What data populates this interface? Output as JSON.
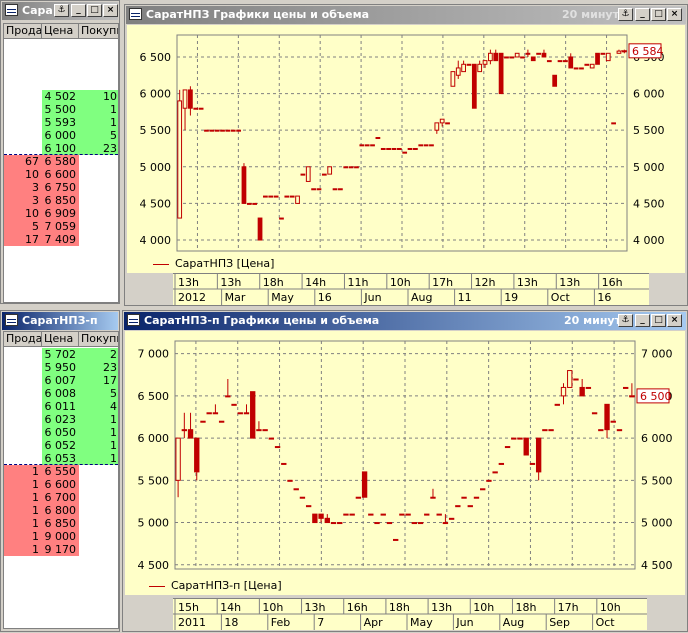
{
  "colors": {
    "ask": "#ff8080",
    "bid": "#80ff80",
    "chart_bg": "#ffffc8",
    "candle": "#c00000"
  },
  "book1": {
    "title": "Сара",
    "headers": [
      "Прода",
      "Цена",
      "Покупка"
    ],
    "rows": [
      {
        "sell": "",
        "price": "4 502",
        "buy": "10",
        "side": "bid"
      },
      {
        "sell": "",
        "price": "5 500",
        "buy": "1",
        "side": "bid"
      },
      {
        "sell": "",
        "price": "5 593",
        "buy": "1",
        "side": "bid"
      },
      {
        "sell": "",
        "price": "6 000",
        "buy": "5",
        "side": "bid"
      },
      {
        "sell": "",
        "price": "6 100",
        "buy": "23",
        "side": "bid"
      },
      {
        "sell": "67",
        "price": "6 580",
        "buy": "",
        "side": "ask"
      },
      {
        "sell": "10",
        "price": "6 600",
        "buy": "",
        "side": "ask"
      },
      {
        "sell": "3",
        "price": "6 750",
        "buy": "",
        "side": "ask"
      },
      {
        "sell": "3",
        "price": "6 850",
        "buy": "",
        "side": "ask"
      },
      {
        "sell": "10",
        "price": "6 909",
        "buy": "",
        "side": "ask"
      },
      {
        "sell": "5",
        "price": "7 059",
        "buy": "",
        "side": "ask"
      },
      {
        "sell": "17",
        "price": "7 409",
        "buy": "",
        "side": "ask"
      }
    ]
  },
  "book2": {
    "title": "СаратНПЗ-п",
    "headers": [
      "Прода",
      "Цена",
      "Покупка"
    ],
    "rows": [
      {
        "sell": "",
        "price": "5 702",
        "buy": "2",
        "side": "bid"
      },
      {
        "sell": "",
        "price": "5 950",
        "buy": "23",
        "side": "bid"
      },
      {
        "sell": "",
        "price": "6 007",
        "buy": "17",
        "side": "bid"
      },
      {
        "sell": "",
        "price": "6 008",
        "buy": "5",
        "side": "bid"
      },
      {
        "sell": "",
        "price": "6 011",
        "buy": "4",
        "side": "bid"
      },
      {
        "sell": "",
        "price": "6 023",
        "buy": "1",
        "side": "bid"
      },
      {
        "sell": "",
        "price": "6 050",
        "buy": "1",
        "side": "bid"
      },
      {
        "sell": "",
        "price": "6 052",
        "buy": "1",
        "side": "bid"
      },
      {
        "sell": "",
        "price": "6 053",
        "buy": "1",
        "side": "bid"
      },
      {
        "sell": "1",
        "price": "6 550",
        "buy": "",
        "side": "ask"
      },
      {
        "sell": "1",
        "price": "6 600",
        "buy": "",
        "side": "ask"
      },
      {
        "sell": "1",
        "price": "6 700",
        "buy": "",
        "side": "ask"
      },
      {
        "sell": "1",
        "price": "6 800",
        "buy": "",
        "side": "ask"
      },
      {
        "sell": "1",
        "price": "6 850",
        "buy": "",
        "side": "ask"
      },
      {
        "sell": "1",
        "price": "9 000",
        "buy": "",
        "side": "ask"
      },
      {
        "sell": "1",
        "price": "9 170",
        "buy": "",
        "side": "ask"
      }
    ]
  },
  "chart1": {
    "title": "СаратНПЗ Графики цены и объема",
    "interval": "20 минут",
    "legend": "СаратНПЗ [Цена]",
    "current": "6 584",
    "current_value": 6584,
    "ylim": [
      3850,
      6800
    ],
    "yticks": [
      4000,
      4500,
      5000,
      5500,
      6000,
      6500
    ],
    "ytick_labels": [
      "4 000",
      "4 500",
      "5 000",
      "5 500",
      "6 000",
      "6 500"
    ],
    "time_top": [
      "13h",
      "13h",
      "18h",
      "14h",
      "11h",
      "10h",
      "17h",
      "12h",
      "13h",
      "13h",
      "16h"
    ],
    "time_bottom": [
      "2012",
      "Mar",
      "May",
      "16",
      "Jun",
      "Aug",
      "11",
      "19",
      "Oct",
      "16"
    ],
    "series": [
      {
        "o": 4300,
        "c": 5900,
        "h": 6050,
        "l": 4300
      },
      {
        "o": 5800,
        "c": 6050,
        "h": 6050,
        "l": 5500
      },
      {
        "o": 6050,
        "c": 5800,
        "h": 6100,
        "l": 5700
      },
      {
        "o": 5800,
        "c": 5800,
        "h": 5800,
        "l": 5800
      },
      {
        "o": 5800,
        "c": 5800,
        "h": 5800,
        "l": 5800
      },
      {
        "o": 5500,
        "c": 5500,
        "h": 5500,
        "l": 5500
      },
      {
        "o": 5500,
        "c": 5500,
        "h": 5500,
        "l": 5500
      },
      {
        "o": 5500,
        "c": 5500,
        "h": 5500,
        "l": 5500
      },
      {
        "o": 5500,
        "c": 5500,
        "h": 5500,
        "l": 5500
      },
      {
        "o": 5500,
        "c": 5500,
        "h": 5500,
        "l": 5500
      },
      {
        "o": 5500,
        "c": 5500,
        "h": 5500,
        "l": 5500
      },
      {
        "o": 5500,
        "c": 5500,
        "h": 5500,
        "l": 5500
      },
      {
        "o": 5000,
        "c": 4500,
        "h": 5050,
        "l": 4500
      },
      {
        "o": 4500,
        "c": 4500,
        "h": 4500,
        "l": 4500
      },
      {
        "o": 4500,
        "c": 4500,
        "h": 4500,
        "l": 4500
      },
      {
        "o": 4300,
        "c": 4000,
        "h": 4300,
        "l": 4000
      },
      {
        "o": 4600,
        "c": 4600,
        "h": 4600,
        "l": 4600
      },
      {
        "o": 4600,
        "c": 4600,
        "h": 4600,
        "l": 4600
      },
      {
        "o": 4600,
        "c": 4600,
        "h": 4600,
        "l": 4600
      },
      {
        "o": 4300,
        "c": 4300,
        "h": 4300,
        "l": 4300
      },
      {
        "o": 4600,
        "c": 4600,
        "h": 4600,
        "l": 4600
      },
      {
        "o": 4600,
        "c": 4600,
        "h": 4600,
        "l": 4600
      },
      {
        "o": 4500,
        "c": 4600,
        "h": 4600,
        "l": 4500
      },
      {
        "o": 4900,
        "c": 4900,
        "h": 4900,
        "l": 4900
      },
      {
        "o": 4800,
        "c": 5000,
        "h": 5000,
        "l": 4800
      },
      {
        "o": 4700,
        "c": 4700,
        "h": 4700,
        "l": 4700
      },
      {
        "o": 4700,
        "c": 4700,
        "h": 4700,
        "l": 4700
      },
      {
        "o": 4900,
        "c": 4900,
        "h": 4900,
        "l": 4900
      },
      {
        "o": 4900,
        "c": 5000,
        "h": 5000,
        "l": 4900
      },
      {
        "o": 4700,
        "c": 4700,
        "h": 4700,
        "l": 4700
      },
      {
        "o": 4700,
        "c": 4700,
        "h": 4700,
        "l": 4700
      },
      {
        "o": 5000,
        "c": 5000,
        "h": 5000,
        "l": 5000
      },
      {
        "o": 5000,
        "c": 5000,
        "h": 5000,
        "l": 5000
      },
      {
        "o": 5000,
        "c": 5000,
        "h": 5000,
        "l": 5000
      },
      {
        "o": 5300,
        "c": 5300,
        "h": 5300,
        "l": 5300
      },
      {
        "o": 5300,
        "c": 5300,
        "h": 5300,
        "l": 5300
      },
      {
        "o": 5300,
        "c": 5300,
        "h": 5300,
        "l": 5300
      },
      {
        "o": 5400,
        "c": 5400,
        "h": 5400,
        "l": 5400
      },
      {
        "o": 5250,
        "c": 5250,
        "h": 5250,
        "l": 5250
      },
      {
        "o": 5250,
        "c": 5250,
        "h": 5250,
        "l": 5250
      },
      {
        "o": 5250,
        "c": 5250,
        "h": 5250,
        "l": 5250
      },
      {
        "o": 5250,
        "c": 5250,
        "h": 5250,
        "l": 5250
      },
      {
        "o": 5200,
        "c": 5200,
        "h": 5200,
        "l": 5200
      },
      {
        "o": 5250,
        "c": 5250,
        "h": 5250,
        "l": 5250
      },
      {
        "o": 5250,
        "c": 5250,
        "h": 5250,
        "l": 5250
      },
      {
        "o": 5300,
        "c": 5300,
        "h": 5300,
        "l": 5300
      },
      {
        "o": 5300,
        "c": 5300,
        "h": 5300,
        "l": 5300
      },
      {
        "o": 5300,
        "c": 5300,
        "h": 5300,
        "l": 5300
      },
      {
        "o": 5500,
        "c": 5600,
        "h": 5600,
        "l": 5450
      },
      {
        "o": 5600,
        "c": 5650,
        "h": 5650,
        "l": 5550
      },
      {
        "o": 5600,
        "c": 5600,
        "h": 5600,
        "l": 5600
      },
      {
        "o": 6100,
        "c": 6300,
        "h": 6300,
        "l": 6100
      },
      {
        "o": 6250,
        "c": 6350,
        "h": 6450,
        "l": 6200
      },
      {
        "o": 6300,
        "c": 6400,
        "h": 6450,
        "l": 6300
      },
      {
        "o": 6400,
        "c": 6400,
        "h": 6400,
        "l": 6400
      },
      {
        "o": 6400,
        "c": 5800,
        "h": 6400,
        "l": 5800
      },
      {
        "o": 6300,
        "c": 6400,
        "h": 6450,
        "l": 6300
      },
      {
        "o": 6400,
        "c": 6450,
        "h": 6450,
        "l": 6350
      },
      {
        "o": 6450,
        "c": 6550,
        "h": 6600,
        "l": 6400
      },
      {
        "o": 6550,
        "c": 6450,
        "h": 6600,
        "l": 6450
      },
      {
        "o": 6550,
        "c": 6000,
        "h": 6550,
        "l": 6000
      },
      {
        "o": 6500,
        "c": 6500,
        "h": 6500,
        "l": 6500
      },
      {
        "o": 6500,
        "c": 6500,
        "h": 6500,
        "l": 6500
      },
      {
        "o": 6500,
        "c": 6550,
        "h": 6550,
        "l": 6500
      },
      {
        "o": 6500,
        "c": 6500,
        "h": 6500,
        "l": 6500
      },
      {
        "o": 6550,
        "c": 6550,
        "h": 6600,
        "l": 6500
      },
      {
        "o": 6500,
        "c": 6450,
        "h": 6500,
        "l": 6450
      },
      {
        "o": 6550,
        "c": 6550,
        "h": 6550,
        "l": 6550
      },
      {
        "o": 6550,
        "c": 6500,
        "h": 6600,
        "l": 6500
      },
      {
        "o": 6450,
        "c": 6450,
        "h": 6450,
        "l": 6450
      },
      {
        "o": 6250,
        "c": 6100,
        "h": 6250,
        "l": 6100
      },
      {
        "o": 6450,
        "c": 6450,
        "h": 6450,
        "l": 6450
      },
      {
        "o": 6450,
        "c": 6450,
        "h": 6450,
        "l": 6450
      },
      {
        "o": 6500,
        "c": 6350,
        "h": 6550,
        "l": 6350
      },
      {
        "o": 6350,
        "c": 6350,
        "h": 6350,
        "l": 6350
      },
      {
        "o": 6350,
        "c": 6350,
        "h": 6350,
        "l": 6350
      },
      {
        "o": 6400,
        "c": 6400,
        "h": 6400,
        "l": 6400
      },
      {
        "o": 6350,
        "c": 6400,
        "h": 6400,
        "l": 6350
      },
      {
        "o": 6550,
        "c": 6400,
        "h": 6550,
        "l": 6400
      },
      {
        "o": 6550,
        "c": 6550,
        "h": 6550,
        "l": 6550
      },
      {
        "o": 6450,
        "c": 6550,
        "h": 6550,
        "l": 6450
      },
      {
        "o": 5600,
        "c": 5600,
        "h": 5600,
        "l": 5600
      },
      {
        "o": 6550,
        "c": 6580,
        "h": 6600,
        "l": 6550
      },
      {
        "o": 6580,
        "c": 6584,
        "h": 6600,
        "l": 6550
      }
    ]
  },
  "chart2": {
    "title": "СаратНПЗ-п Графики цены и объема",
    "interval": "20 минут",
    "legend": "СаратНПЗ-п [Цена]",
    "current": "6 500",
    "current_value": 6500,
    "ylim": [
      4450,
      7150
    ],
    "yticks": [
      4500,
      5000,
      5500,
      6000,
      6500,
      7000
    ],
    "ytick_labels": [
      "4 500",
      "5 000",
      "5 500",
      "6 000",
      "6 500",
      "7 000"
    ],
    "time_top": [
      "15h",
      "14h",
      "10h",
      "13h",
      "16h",
      "18h",
      "13h",
      "10h",
      "18h",
      "17h",
      "10h"
    ],
    "time_bottom": [
      "2011",
      "18",
      "Feb",
      "7",
      "Apr",
      "May",
      "Jun",
      "Aug",
      "Sep",
      "Oct"
    ],
    "series": [
      {
        "o": 5500,
        "c": 6000,
        "h": 6000,
        "l": 5300
      },
      {
        "o": 6100,
        "c": 6100,
        "h": 6300,
        "l": 6000
      },
      {
        "o": 6100,
        "c": 6000,
        "h": 6300,
        "l": 6000
      },
      {
        "o": 6000,
        "c": 5600,
        "h": 6000,
        "l": 5500
      },
      {
        "o": 6200,
        "c": 6200,
        "h": 6200,
        "l": 6200
      },
      {
        "o": 6300,
        "c": 6300,
        "h": 6300,
        "l": 6300
      },
      {
        "o": 6300,
        "c": 6300,
        "h": 6400,
        "l": 6300
      },
      {
        "o": 6200,
        "c": 6200,
        "h": 6200,
        "l": 6200
      },
      {
        "o": 6500,
        "c": 6500,
        "h": 6700,
        "l": 6500
      },
      {
        "o": 6400,
        "c": 6400,
        "h": 6400,
        "l": 6400
      },
      {
        "o": 6300,
        "c": 6300,
        "h": 6300,
        "l": 6300
      },
      {
        "o": 6300,
        "c": 6300,
        "h": 6400,
        "l": 6300
      },
      {
        "o": 6550,
        "c": 6000,
        "h": 6550,
        "l": 6000
      },
      {
        "o": 6100,
        "c": 6100,
        "h": 6200,
        "l": 6100
      },
      {
        "o": 6100,
        "c": 6100,
        "h": 6100,
        "l": 6100
      },
      {
        "o": 6000,
        "c": 6000,
        "h": 6000,
        "l": 6000
      },
      {
        "o": 5900,
        "c": 5900,
        "h": 5900,
        "l": 5900
      },
      {
        "o": 5700,
        "c": 5700,
        "h": 5700,
        "l": 5700
      },
      {
        "o": 5500,
        "c": 5500,
        "h": 5500,
        "l": 5500
      },
      {
        "o": 5400,
        "c": 5400,
        "h": 5400,
        "l": 5400
      },
      {
        "o": 5300,
        "c": 5300,
        "h": 5300,
        "l": 5300
      },
      {
        "o": 5200,
        "c": 5200,
        "h": 5200,
        "l": 5200
      },
      {
        "o": 5100,
        "c": 5000,
        "h": 5100,
        "l": 5000
      },
      {
        "o": 5100,
        "c": 5050,
        "h": 5100,
        "l": 5000
      },
      {
        "o": 5050,
        "c": 5000,
        "h": 5100,
        "l": 5000
      },
      {
        "o": 5000,
        "c": 5000,
        "h": 5000,
        "l": 5000
      },
      {
        "o": 5000,
        "c": 5000,
        "h": 5000,
        "l": 5000
      },
      {
        "o": 5100,
        "c": 5100,
        "h": 5100,
        "l": 5100
      },
      {
        "o": 5100,
        "c": 5100,
        "h": 5100,
        "l": 5100
      },
      {
        "o": 5300,
        "c": 5300,
        "h": 5300,
        "l": 5300
      },
      {
        "o": 5600,
        "c": 5300,
        "h": 5600,
        "l": 5300
      },
      {
        "o": 5100,
        "c": 5100,
        "h": 5100,
        "l": 5100
      },
      {
        "o": 5000,
        "c": 5000,
        "h": 5000,
        "l": 5000
      },
      {
        "o": 5100,
        "c": 5100,
        "h": 5100,
        "l": 5100
      },
      {
        "o": 5000,
        "c": 5000,
        "h": 5000,
        "l": 5000
      },
      {
        "o": 4800,
        "c": 4800,
        "h": 4800,
        "l": 4800
      },
      {
        "o": 5100,
        "c": 5100,
        "h": 5100,
        "l": 5100
      },
      {
        "o": 5100,
        "c": 5100,
        "h": 5100,
        "l": 5100
      },
      {
        "o": 5000,
        "c": 5000,
        "h": 5000,
        "l": 5000
      },
      {
        "o": 5000,
        "c": 5000,
        "h": 5000,
        "l": 5000
      },
      {
        "o": 5100,
        "c": 5100,
        "h": 5100,
        "l": 5100
      },
      {
        "o": 5300,
        "c": 5300,
        "h": 5400,
        "l": 5300
      },
      {
        "o": 5100,
        "c": 5100,
        "h": 5100,
        "l": 5100
      },
      {
        "o": 5000,
        "c": 5000,
        "h": 5100,
        "l": 5000
      },
      {
        "o": 5050,
        "c": 5050,
        "h": 5050,
        "l": 5050
      },
      {
        "o": 5200,
        "c": 5200,
        "h": 5200,
        "l": 5200
      },
      {
        "o": 5300,
        "c": 5300,
        "h": 5300,
        "l": 5300
      },
      {
        "o": 5200,
        "c": 5200,
        "h": 5200,
        "l": 5200
      },
      {
        "o": 5300,
        "c": 5300,
        "h": 5300,
        "l": 5300
      },
      {
        "o": 5400,
        "c": 5400,
        "h": 5400,
        "l": 5400
      },
      {
        "o": 5500,
        "c": 5500,
        "h": 5500,
        "l": 5500
      },
      {
        "o": 5600,
        "c": 5600,
        "h": 5600,
        "l": 5600
      },
      {
        "o": 5700,
        "c": 5700,
        "h": 5700,
        "l": 5700
      },
      {
        "o": 5900,
        "c": 5900,
        "h": 5900,
        "l": 5900
      },
      {
        "o": 6000,
        "c": 6000,
        "h": 6000,
        "l": 6000
      },
      {
        "o": 6000,
        "c": 6000,
        "h": 6000,
        "l": 6000
      },
      {
        "o": 6000,
        "c": 5800,
        "h": 6000,
        "l": 5800
      },
      {
        "o": 5700,
        "c": 5700,
        "h": 5700,
        "l": 5700
      },
      {
        "o": 6000,
        "c": 5600,
        "h": 6000,
        "l": 5500
      },
      {
        "o": 6100,
        "c": 6100,
        "h": 6100,
        "l": 6100
      },
      {
        "o": 6100,
        "c": 6100,
        "h": 6100,
        "l": 6100
      },
      {
        "o": 6400,
        "c": 6400,
        "h": 6400,
        "l": 6400
      },
      {
        "o": 6500,
        "c": 6600,
        "h": 6650,
        "l": 6400
      },
      {
        "o": 6600,
        "c": 6800,
        "h": 6800,
        "l": 6600
      },
      {
        "o": 6700,
        "c": 6700,
        "h": 6700,
        "l": 6700
      },
      {
        "o": 6600,
        "c": 6500,
        "h": 6700,
        "l": 6500
      },
      {
        "o": 6600,
        "c": 6600,
        "h": 6600,
        "l": 6600
      },
      {
        "o": 6300,
        "c": 6300,
        "h": 6300,
        "l": 6300
      },
      {
        "o": 6100,
        "c": 6100,
        "h": 6100,
        "l": 6100
      },
      {
        "o": 6400,
        "c": 6100,
        "h": 6400,
        "l": 6000
      },
      {
        "o": 6200,
        "c": 6200,
        "h": 6200,
        "l": 6200
      },
      {
        "o": 6100,
        "c": 6100,
        "h": 6100,
        "l": 6100
      },
      {
        "o": 6600,
        "c": 6600,
        "h": 6600,
        "l": 6600
      },
      {
        "o": 6500,
        "c": 6500,
        "h": 6650,
        "l": 6500
      }
    ]
  }
}
